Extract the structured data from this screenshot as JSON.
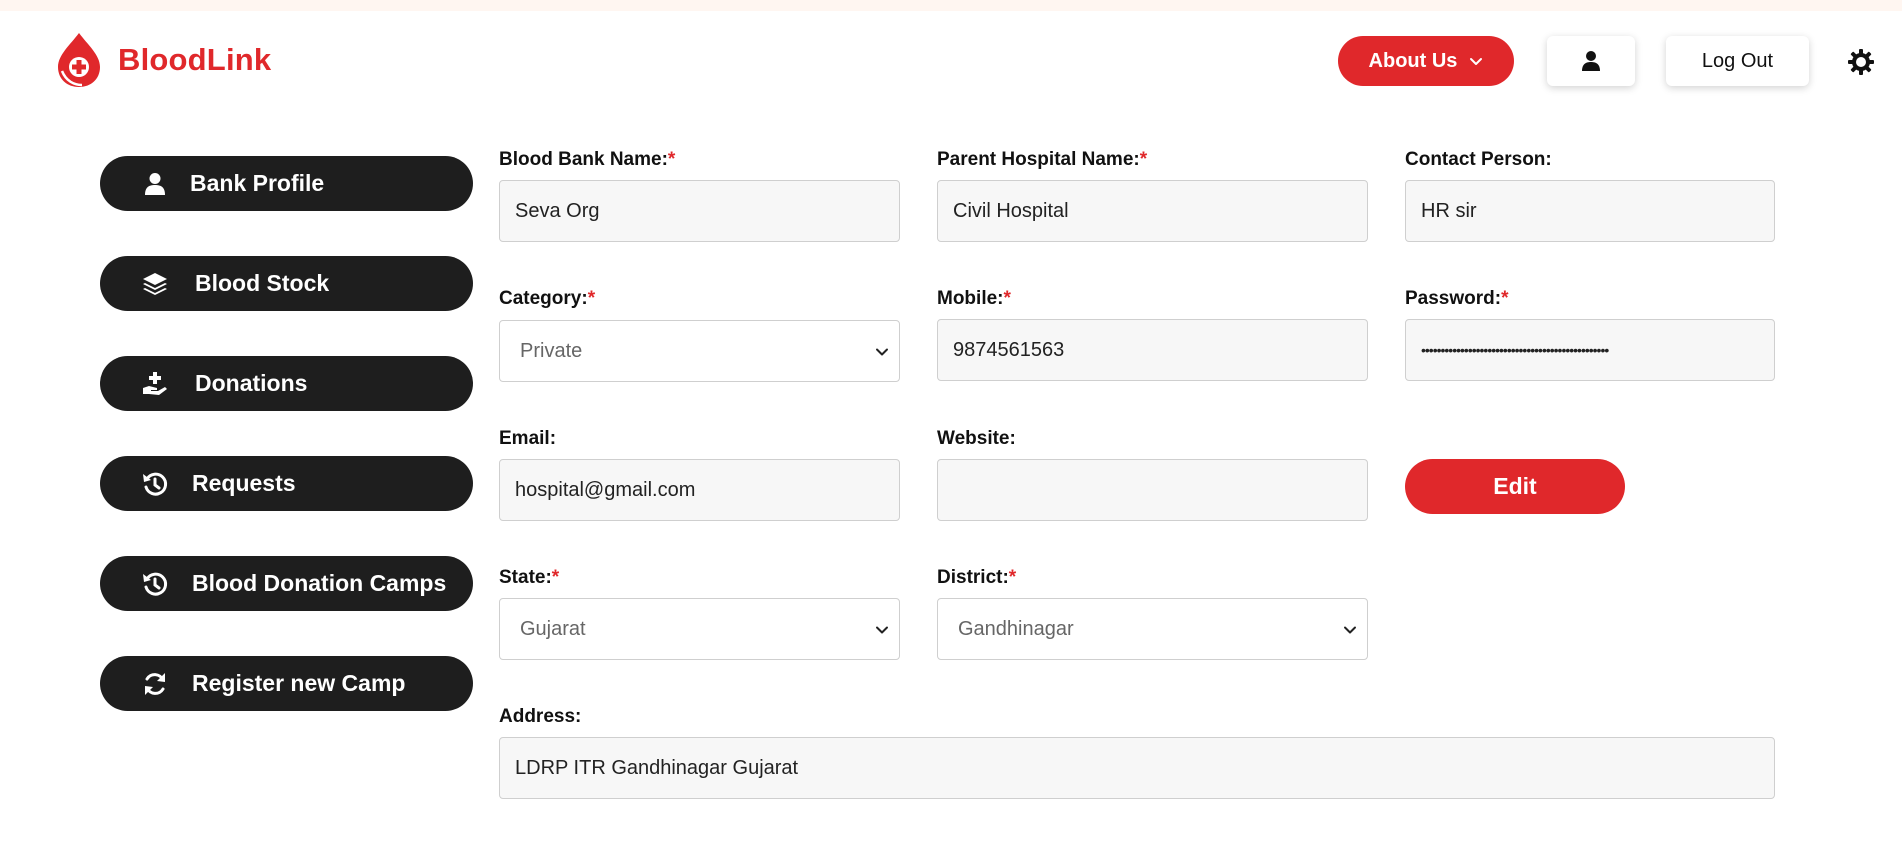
{
  "brand": {
    "name": "BloodLink",
    "color": "#e0282b"
  },
  "header": {
    "about_label": "About Us",
    "logout_label": "Log Out",
    "icons": {
      "about_chevron": "chevron-down-icon",
      "user": "user-icon",
      "theme": "sun-icon"
    }
  },
  "sidebar": {
    "items": [
      {
        "label": "Bank Profile",
        "icon": "user-icon"
      },
      {
        "label": "Blood Stock",
        "icon": "layers-icon"
      },
      {
        "label": "Donations",
        "icon": "hand-donate-icon"
      },
      {
        "label": "Requests",
        "icon": "history-icon"
      },
      {
        "label": "Blood Donation Camps",
        "icon": "history-icon"
      },
      {
        "label": "Register new Camp",
        "icon": "refresh-icon"
      }
    ]
  },
  "form": {
    "bank_name": {
      "label": "Blood Bank Name:",
      "required": "*",
      "value": "Seva Org"
    },
    "parent_hospital": {
      "label": "Parent Hospital Name:",
      "required": "*",
      "value": "Civil Hospital"
    },
    "contact_person": {
      "label": "Contact Person:",
      "value": "HR sir"
    },
    "category": {
      "label": "Category:",
      "required": "*",
      "value": "Private"
    },
    "mobile": {
      "label": "Mobile:",
      "required": "*",
      "value": "9874561563"
    },
    "password": {
      "label": "Password:",
      "required": "*",
      "value": "••••••••••••••••••••••••••••••••••••••••••••••••"
    },
    "email": {
      "label": "Email:",
      "value": "hospital@gmail.com"
    },
    "website": {
      "label": "Website:",
      "value": ""
    },
    "edit_label": "Edit",
    "state": {
      "label": "State:",
      "required": "*",
      "value": "Gujarat"
    },
    "district": {
      "label": "District:",
      "required": "*",
      "value": "Gandhinagar"
    },
    "address": {
      "label": "Address:",
      "value": "LDRP ITR Gandhinagar Gujarat"
    }
  }
}
